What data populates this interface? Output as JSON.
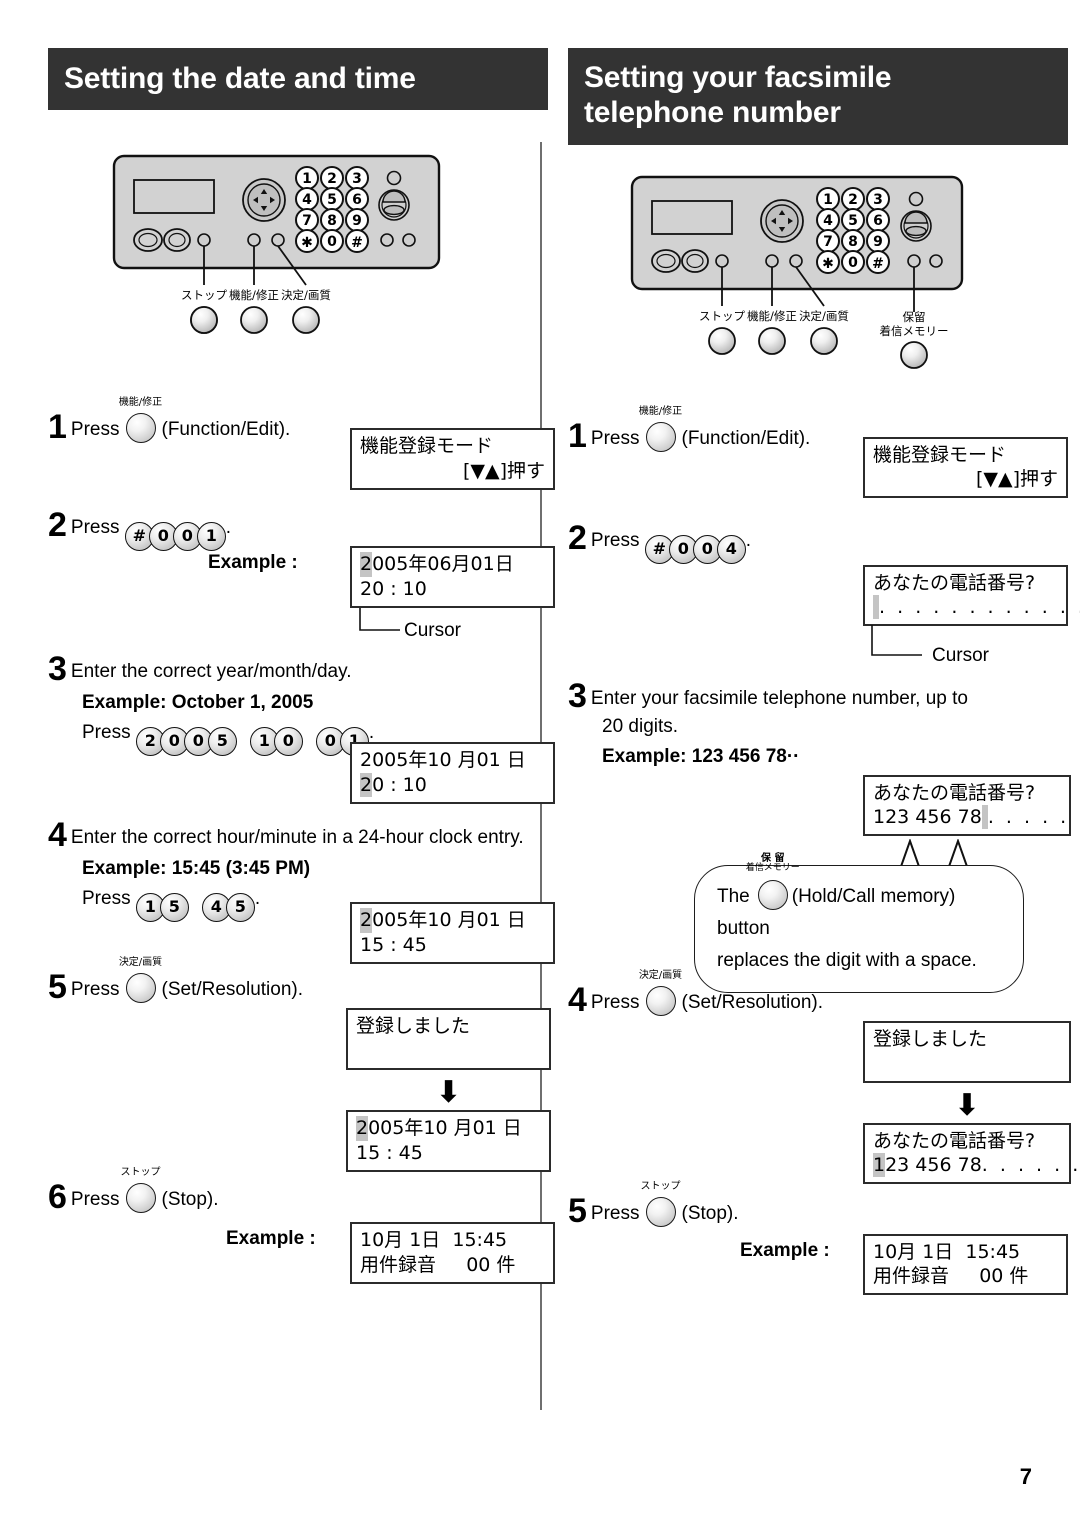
{
  "page": {
    "number": "7"
  },
  "left_section": {
    "title": "Setting the date and time",
    "device": {
      "keypad": [
        "1",
        "2",
        "3",
        "4",
        "5",
        "6",
        "7",
        "8",
        "9",
        "*",
        "0",
        "#"
      ],
      "labels": [
        {
          "name": "stop",
          "jp": "ストップ"
        },
        {
          "name": "function-edit",
          "jp": "機能/修正"
        },
        {
          "name": "set-resolution",
          "jp": "決定/画質"
        }
      ]
    },
    "steps": [
      {
        "num": "1",
        "press_label": "Press",
        "button_caption": "機能/修正",
        "button_name": "(Function/Edit).",
        "lcd": {
          "line1": "機能登録モード",
          "line2": "[▼▲]押す"
        }
      },
      {
        "num": "2",
        "press_label": "Press",
        "keys": [
          [
            "#",
            "0",
            "0",
            "1"
          ]
        ],
        "trailing": ".",
        "example_label": "Example :",
        "lcd": {
          "cursor": "2",
          "line1_rest": "005年06月01日",
          "line2_cursor": "2",
          "line2_rest": "0 : 10"
        },
        "cursor_label": "Cursor"
      },
      {
        "num": "3",
        "text": "Enter the correct year/month/day.",
        "example_bold": "Example: October 1, 2005",
        "press_label": "Press",
        "keys": [
          [
            "2",
            "0",
            "0",
            "5"
          ],
          [
            "1",
            "0"
          ],
          [
            "0",
            "1"
          ]
        ],
        "trailing": ".",
        "lcd": {
          "line1": "2005年10 月01 日",
          "line2_cursor": "2",
          "line2_rest": "0 : 10"
        }
      },
      {
        "num": "4",
        "text": "Enter the correct hour/minute in a 24-hour clock entry.",
        "example_bold": "Example: 15:45 (3:45 PM)",
        "press_label": "Press",
        "keys": [
          [
            "1",
            "5"
          ],
          [
            "4",
            "5"
          ]
        ],
        "trailing": ".",
        "lcd": {
          "line1_cursor": "2",
          "line1_rest": "005年10 月01 日",
          "line2": "15 : 45"
        }
      },
      {
        "num": "5",
        "press_label": "Press",
        "button_caption": "決定/画質",
        "button_name": "(Set/Resolution).",
        "lcd1": {
          "line1": "登録しました",
          "line2": ""
        },
        "arrow": "⬇",
        "lcd2": {
          "line1_cursor": "2",
          "line1_rest": "005年10 月01 日",
          "line2": "15 : 45"
        }
      },
      {
        "num": "6",
        "press_label": "Press",
        "button_caption": "ストップ",
        "button_name": "(Stop).",
        "example_label": "Example :",
        "lcd": {
          "line1": "10月 1日  15:45",
          "line2": "用件録音     00 件"
        }
      }
    ]
  },
  "right_section": {
    "title_line1": "Setting your facsimile",
    "title_line2": "telephone number",
    "device": {
      "keypad": [
        "1",
        "2",
        "3",
        "4",
        "5",
        "6",
        "7",
        "8",
        "9",
        "*",
        "0",
        "#"
      ],
      "labels": [
        {
          "name": "stop",
          "jp": "ストップ"
        },
        {
          "name": "function-edit",
          "jp": "機能/修正"
        },
        {
          "name": "set-resolution",
          "jp": "決定/画質"
        },
        {
          "name": "hold-call-memory",
          "jp1": "保留",
          "jp2": "着信メモリー"
        }
      ]
    },
    "steps": [
      {
        "num": "1",
        "press_label": "Press",
        "button_caption": "機能/修正",
        "button_name": "(Function/Edit).",
        "lcd": {
          "line1": "機能登録モード",
          "line2": "[▼▲]押す"
        }
      },
      {
        "num": "2",
        "press_label": "Press",
        "keys": [
          [
            "#",
            "0",
            "0",
            "4"
          ]
        ],
        "trailing": ".",
        "lcd": {
          "line1": "あなたの電話番号?",
          "line2_dots": ". . . . . . . . . . . . ."
        },
        "cursor_label": "Cursor"
      },
      {
        "num": "3",
        "text_line1": "Enter your facsimile telephone number, up to",
        "text_line2": "20 digits.",
        "example_bold": "Example: 123 456 78··",
        "lcd": {
          "line1": "あなたの電話番号?",
          "line2": "123 456 78",
          "line2_dots": ". . . . ."
        },
        "bubble": {
          "prefix": "The",
          "button_caption1": "保 留",
          "button_caption2": "着信メモリー",
          "mid": "(Hold/Call memory) button",
          "line2": "replaces the digit with a space."
        }
      },
      {
        "num": "4",
        "press_label": "Press",
        "button_caption": "決定/画質",
        "button_name": "(Set/Resolution).",
        "lcd1": {
          "line1": "登録しました",
          "line2": ""
        },
        "arrow": "⬇",
        "lcd2": {
          "line1": "あなたの電話番号?",
          "line2_cursor": "1",
          "line2_rest": "23 456 78",
          "line2_dots": ". . . . . ."
        }
      },
      {
        "num": "5",
        "press_label": "Press",
        "button_caption": "ストップ",
        "button_name": "(Stop).",
        "example_label": "Example :",
        "lcd": {
          "line1": "10月 1日  15:45",
          "line2": "用件録音     00 件"
        }
      }
    ]
  }
}
